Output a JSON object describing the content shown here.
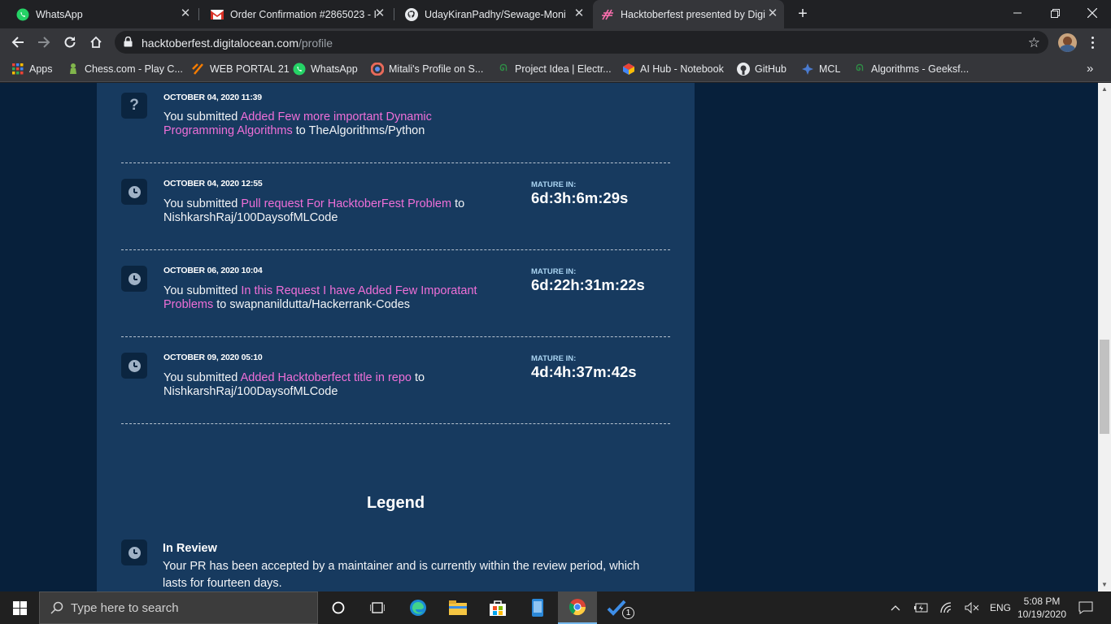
{
  "browser": {
    "tabs": [
      {
        "title": "WhatsApp",
        "icon": "whatsapp-icon"
      },
      {
        "title": "Order Confirmation #2865023 - I",
        "icon": "gmail-icon"
      },
      {
        "title": "UdayKiranPadhy/Sewage-Monito",
        "icon": "github-icon"
      },
      {
        "title": "Hacktoberfest presented by Digit",
        "icon": "hacktoberfest-icon",
        "active": true
      }
    ],
    "new_tab": "+",
    "url_host": "hacktoberfest.digitalocean.com",
    "url_path": "/profile",
    "bookmarks": [
      {
        "label": "Apps",
        "icon": "apps-grid-icon"
      },
      {
        "label": "Chess.com - Play C...",
        "icon": "chess-icon"
      },
      {
        "label": "WEB PORTAL 21",
        "icon": "web-portal-icon"
      },
      {
        "label": "WhatsApp",
        "icon": "whatsapp-icon"
      },
      {
        "label": "Mitali's Profile on S...",
        "icon": "profile-icon"
      },
      {
        "label": "Project Idea | Electr...",
        "icon": "geeks-icon"
      },
      {
        "label": "AI Hub - Notebook",
        "icon": "ai-hub-icon"
      },
      {
        "label": "GitHub",
        "icon": "github-icon"
      },
      {
        "label": "MCL",
        "icon": "mcl-icon"
      },
      {
        "label": "Algorithms - Geeksf...",
        "icon": "geeks-icon"
      }
    ]
  },
  "entries": [
    {
      "status_icon": "question-icon",
      "date": "OCTOBER 04, 2020 11:39",
      "prefix": "You submitted ",
      "pr_title": "Added Few more important Dynamic Programming Algorithms",
      "to": " to ",
      "repo": "TheAlgorithms/Python",
      "mature_label": "",
      "mature_value": ""
    },
    {
      "status_icon": "clock-icon",
      "date": "OCTOBER 04, 2020 12:55",
      "prefix": "You submitted ",
      "pr_title": "Pull request For HacktoberFest Problem",
      "to": " to ",
      "repo": "NishkarshRaj/100DaysofMLCode",
      "mature_label": "MATURE IN:",
      "mature_value": "6d:3h:6m:29s"
    },
    {
      "status_icon": "clock-icon",
      "date": "OCTOBER 06, 2020 10:04",
      "prefix": "You submitted ",
      "pr_title": "In this Request I have Added Few Imporatant Problems",
      "to": " to ",
      "repo": "swapnanildutta/Hackerrank-Codes",
      "mature_label": "MATURE IN:",
      "mature_value": "6d:22h:31m:22s"
    },
    {
      "status_icon": "clock-icon",
      "date": "OCTOBER 09, 2020 05:10",
      "prefix": "You submitted ",
      "pr_title": "Added Hacktoberfect title in repo",
      "to": " to ",
      "repo": "NishkarshRaj/100DaysofMLCode",
      "mature_label": "MATURE IN:",
      "mature_value": "4d:4h:37m:42s"
    }
  ],
  "legend": {
    "heading": "Legend",
    "item_title": "In Review",
    "item_text": "Your PR has been accepted by a maintainer and is currently within the review period, which lasts for fourteen days."
  },
  "taskbar": {
    "search_placeholder": "Type here to search",
    "lang": "ENG",
    "time": "5:08 PM",
    "date": "10/19/2020",
    "badge": "1"
  },
  "colors": {
    "page_bg": "#07203b",
    "panel_bg": "#173a5f",
    "pr_link": "#ef6fd8",
    "mature_label": "#a9d3f0"
  }
}
